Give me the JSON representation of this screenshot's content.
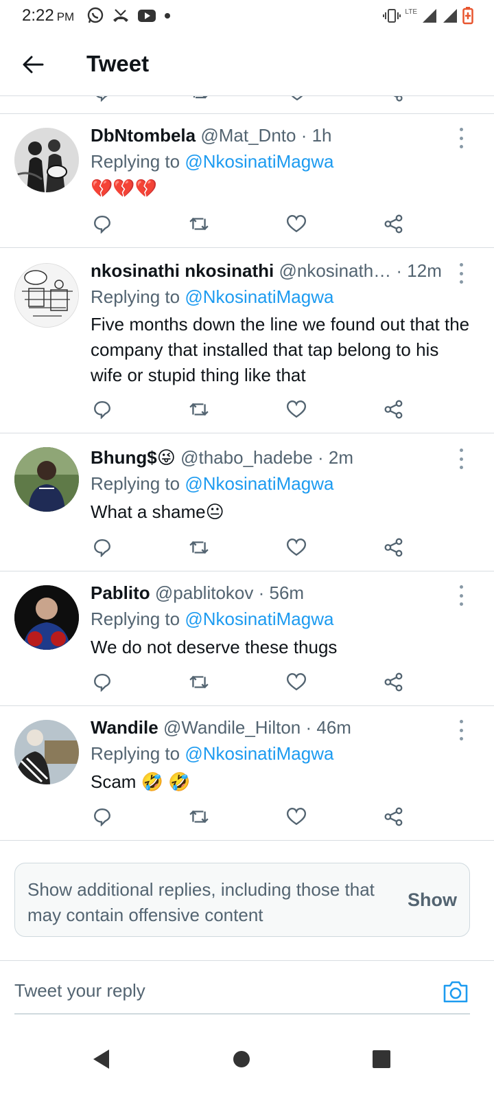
{
  "status_bar": {
    "time": "2:22",
    "ampm": "PM",
    "left_icons": [
      "whatsapp-icon",
      "missed-call-icon",
      "youtube-icon",
      "dot-icon"
    ],
    "right_icons": [
      "vibrate-icon",
      "lte-signal-icon",
      "signal-icon",
      "signal-icon",
      "battery-icon"
    ],
    "network_label": "LTE"
  },
  "header": {
    "title": "Tweet",
    "back_icon": "back-arrow-icon"
  },
  "tweets": [
    {
      "name": "DbNtombela",
      "handle": "@Mat_Dnto",
      "time": "· 1h",
      "replying_prefix": "Replying to",
      "replying_to": "@NkosinatiMagwa",
      "text": "💔💔💔"
    },
    {
      "name": "nkosinathi nkosinathi",
      "handle": "@nkosinath…",
      "time": "· 12m",
      "replying_prefix": "Replying to",
      "replying_to": "@NkosinatiMagwa",
      "text": "Five months down the line we found out that the company that installed that tap belong to his wife or stupid thing like that"
    },
    {
      "name": "Bhung$😜",
      "handle": "@thabo_hadebe",
      "time": "· 2m",
      "replying_prefix": "Replying to",
      "replying_to": "@NkosinatiMagwa",
      "text": "What a shame😐"
    },
    {
      "name": "Pablito",
      "handle": "@pablitokov",
      "time": "· 56m",
      "replying_prefix": "Replying to",
      "replying_to": "@NkosinatiMagwa",
      "text": "We do not deserve these thugs"
    },
    {
      "name": "Wandile",
      "handle": "@Wandile_Hilton",
      "time": "· 46m",
      "replying_prefix": "Replying to",
      "replying_to": "@NkosinatiMagwa",
      "text": "Scam 🤣 🤣"
    }
  ],
  "show_more": {
    "text": "Show additional replies, including those that may contain offensive content",
    "button_label": "Show"
  },
  "reply_bar": {
    "placeholder": "Tweet your reply",
    "camera_icon": "camera-icon"
  },
  "nav_bar": {
    "icons": [
      "nav-back-icon",
      "nav-home-icon",
      "nav-recents-icon"
    ]
  },
  "colors": {
    "accent": "#1d9bf0",
    "secondary_text": "#536471",
    "divider": "#d8dde1",
    "battery": "#e8552f"
  }
}
